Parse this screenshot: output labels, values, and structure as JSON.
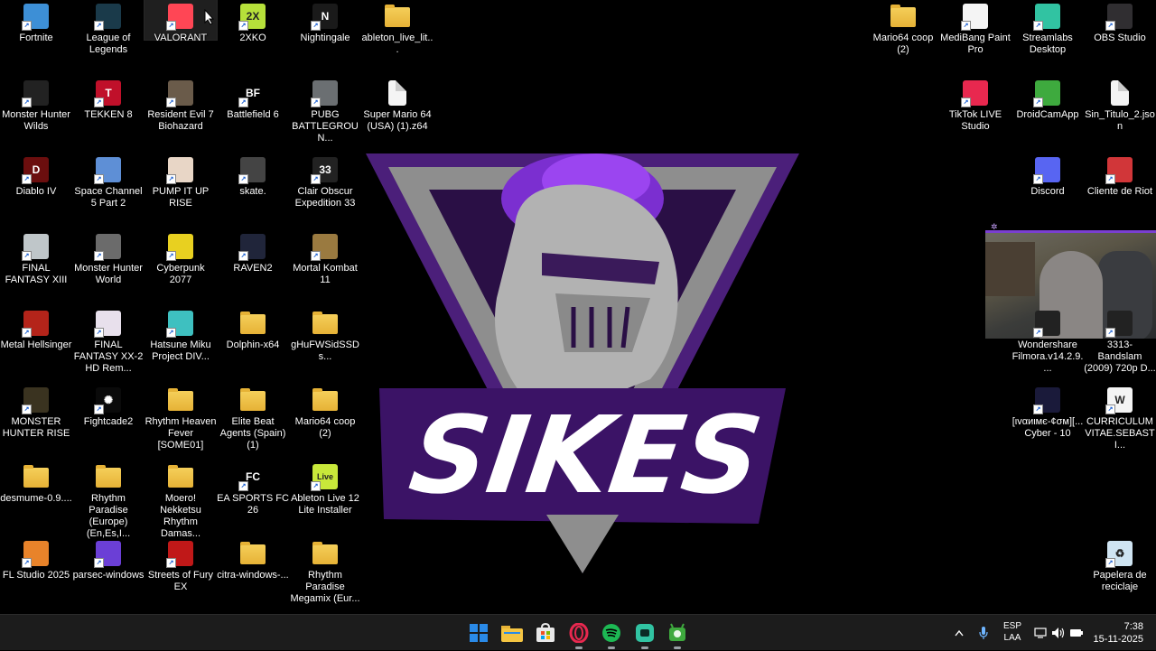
{
  "desktop": {
    "col1": [
      {
        "label": "Fortnite",
        "icon": "fortnite-icon",
        "color": "#3d8fd6",
        "glyph": ""
      },
      {
        "label": "Monster Hunter Wilds",
        "icon": "monster-hunter-wilds-icon",
        "color": "#222",
        "glyph": ""
      },
      {
        "label": "Diablo IV",
        "icon": "diablo-iv-icon",
        "color": "#6b0e0e",
        "glyph": "D"
      },
      {
        "label": "FINAL FANTASY XIII",
        "icon": "final-fantasy-xiii-icon",
        "color": "#bfc6c9",
        "glyph": ""
      },
      {
        "label": "Metal Hellsinger",
        "icon": "metal-hellsinger-icon",
        "color": "#b4241a",
        "glyph": ""
      },
      {
        "label": "MONSTER HUNTER RISE",
        "icon": "monster-hunter-rise-icon",
        "color": "#3a3320",
        "glyph": ""
      },
      {
        "label": "desmume-0.9....",
        "icon": "folder-icon",
        "folder": true
      },
      {
        "label": "FL Studio 2025",
        "icon": "fl-studio-icon",
        "color": "#e8832a",
        "glyph": ""
      }
    ],
    "col2": [
      {
        "label": "League of Legends",
        "icon": "league-of-legends-icon",
        "color": "#1a3a4a",
        "glyph": ""
      },
      {
        "label": "TEKKEN 8",
        "icon": "tekken-8-icon",
        "color": "#c0102a",
        "glyph": "T"
      },
      {
        "label": "Space Channel 5 Part 2",
        "icon": "space-channel-5-icon",
        "color": "#5e8fd6",
        "glyph": ""
      },
      {
        "label": "Monster Hunter World",
        "icon": "monster-hunter-world-icon",
        "color": "#6b6b6b",
        "glyph": ""
      },
      {
        "label": "FINAL FANTASY XX-2 HD Rem...",
        "icon": "final-fantasy-x-icon",
        "color": "#e8e0ec",
        "glyph": ""
      },
      {
        "label": "Fightcade2",
        "icon": "fightcade-icon",
        "color": "#0a0a0a",
        "glyph": "✺"
      },
      {
        "label": "Rhythm Paradise (Europe) (En,Es,I...",
        "icon": "folder-icon",
        "folder": true
      },
      {
        "label": "parsec-windows",
        "icon": "parsec-icon",
        "color": "#6b3fd6",
        "glyph": ""
      }
    ],
    "col3": [
      {
        "label": "VALORANT",
        "icon": "valorant-icon",
        "color": "#ff4655",
        "glyph": ""
      },
      {
        "label": "Resident Evil 7 Biohazard",
        "icon": "resident-evil-7-icon",
        "color": "#6a5b4a",
        "glyph": ""
      },
      {
        "label": "PUMP IT UP RISE",
        "icon": "pump-it-up-icon",
        "color": "#e8d6c6",
        "glyph": ""
      },
      {
        "label": "Cyberpunk 2077",
        "icon": "cyberpunk-icon",
        "color": "#e8d020",
        "glyph": ""
      },
      {
        "label": "Hatsune Miku Project DIV...",
        "icon": "hatsune-miku-icon",
        "color": "#3ec0c0",
        "glyph": ""
      },
      {
        "label": "Rhythm Heaven Fever [SOME01]",
        "icon": "folder-icon",
        "folder": true
      },
      {
        "label": "Moero! Nekketsu Rhythm Damas...",
        "icon": "folder-icon",
        "folder": true
      },
      {
        "label": "Streets of Fury EX",
        "icon": "streets-of-fury-icon",
        "color": "#c01818",
        "glyph": ""
      }
    ],
    "col4": [
      {
        "label": "2XKO",
        "icon": "2xko-icon",
        "color": "#b6e03a",
        "glyph": "2X"
      },
      {
        "label": "Battlefield 6",
        "icon": "battlefield-6-icon",
        "color": "#000",
        "glyph": "BF"
      },
      {
        "label": "skate.",
        "icon": "skate-icon",
        "color": "#444",
        "glyph": ""
      },
      {
        "label": "RAVEN2",
        "icon": "raven2-icon",
        "color": "#20253a",
        "glyph": ""
      },
      {
        "label": "Dolphin-x64",
        "icon": "folder-icon",
        "folder": true
      },
      {
        "label": "Elite Beat Agents (Spain) (1)",
        "icon": "folder-icon",
        "folder": true
      },
      {
        "label": "EA SPORTS FC 26",
        "icon": "ea-sports-fc-icon",
        "color": "#000",
        "glyph": "FC"
      },
      {
        "label": "citra-windows-...",
        "icon": "folder-icon",
        "folder": true
      }
    ],
    "col5": [
      {
        "label": "Nightingale",
        "icon": "nightingale-icon",
        "color": "#1a1a1a",
        "glyph": "N"
      },
      {
        "label": "PUBG BATTLEGROUN...",
        "icon": "pubg-icon",
        "color": "#6b6f72",
        "glyph": ""
      },
      {
        "label": "Clair Obscur Expedition 33",
        "icon": "clair-obscur-icon",
        "color": "#222",
        "glyph": "33"
      },
      {
        "label": "Mortal Kombat 11",
        "icon": "mortal-kombat-icon",
        "color": "#9a7a40",
        "glyph": ""
      },
      {
        "label": "gHuFWSidSSDs...",
        "icon": "folder-icon",
        "folder": true
      },
      {
        "label": "Mario64 coop (2)",
        "icon": "folder-icon",
        "folder": true
      },
      {
        "label": "Ableton Live 12 Lite Installer",
        "icon": "ableton-live-icon",
        "color": "#c8e83a",
        "glyph": "Live"
      },
      {
        "label": "Rhythm Paradise Megamix (Eur...",
        "icon": "folder-icon",
        "folder": true
      }
    ],
    "col6": [
      {
        "label": "ableton_live_lit...",
        "icon": "folder-icon",
        "folder": true
      },
      {
        "label": "Super Mario 64 (USA) (1).z64",
        "icon": "file-icon",
        "file": true
      }
    ],
    "right": [
      {
        "label": "Mario64 coop (2)",
        "icon": "folder-icon",
        "folder": true,
        "col": 0,
        "row": 0
      },
      {
        "label": "MediBang Paint Pro",
        "icon": "medibang-paint-icon",
        "color": "#f4f4f4",
        "glyph": "",
        "col": 1,
        "row": 0
      },
      {
        "label": "Streamlabs Desktop",
        "icon": "streamlabs-icon",
        "color": "#31c3a2",
        "glyph": "",
        "col": 2,
        "row": 0
      },
      {
        "label": "OBS Studio",
        "icon": "obs-studio-icon",
        "color": "#302e31",
        "glyph": "",
        "col": 3,
        "row": 0
      },
      {
        "label": "TikTok LIVE Studio",
        "icon": "tiktok-live-icon",
        "color": "#e8284f",
        "glyph": "",
        "col": 1,
        "row": 1
      },
      {
        "label": "DroidCamApp",
        "icon": "droidcam-icon",
        "color": "#3eaa3e",
        "glyph": "",
        "col": 2,
        "row": 1
      },
      {
        "label": "Sin_Titulo_2.json",
        "icon": "file-icon",
        "file": true,
        "col": 3,
        "row": 1
      },
      {
        "label": "Discord",
        "icon": "discord-icon",
        "color": "#5865f2",
        "glyph": "",
        "col": 2,
        "row": 2
      },
      {
        "label": "Cliente de Riot",
        "icon": "riot-client-icon",
        "color": "#d13639",
        "glyph": "",
        "col": 3,
        "row": 2
      },
      {
        "label": "Wondershare Filmora.v14.2.9....",
        "icon": "filmora-icon",
        "color": "#222",
        "glyph": "",
        "col": 2,
        "row": 4
      },
      {
        "label": "3313- Bandslam (2009) 720p D...",
        "icon": "video-file-icon",
        "color": "#222",
        "glyph": "",
        "col": 3,
        "row": 4
      },
      {
        "label": "[ιvαиιмє-¢σм][... Cyber - 10",
        "icon": "video-file-icon",
        "color": "#1a1a3a",
        "glyph": "",
        "col": 2,
        "row": 5
      },
      {
        "label": "CURRICULUM VITAE.SEBASTI...",
        "icon": "word-document-icon",
        "color": "#f4f4f4",
        "glyph": "W",
        "col": 3,
        "row": 5
      },
      {
        "label": "Papelera de reciclaje",
        "icon": "recycle-bin-icon",
        "color": "#cfe4f2",
        "glyph": "♻",
        "col": 3,
        "row": 7
      }
    ]
  },
  "wallpaper": {
    "text": "SIKES",
    "purple": "#4b1f7a",
    "accent": "#8a2be2",
    "gray": "#9a9a9a"
  },
  "webcam": {
    "tag": "✲"
  },
  "taskbar": {
    "apps": [
      {
        "name": "start-button-icon",
        "color": "#2a8ae8"
      },
      {
        "name": "file-explorer-icon",
        "color": "#f5c542"
      },
      {
        "name": "microsoft-store-icon",
        "color": "#2a8ae8"
      },
      {
        "name": "opera-gx-icon",
        "color": "#e8284f"
      },
      {
        "name": "spotify-icon",
        "color": "#1db954"
      },
      {
        "name": "streamlabs-taskbar-icon",
        "color": "#31c3a2"
      },
      {
        "name": "droidcam-taskbar-icon",
        "color": "#3eaa3e"
      }
    ],
    "lang_top": "ESP",
    "lang_bottom": "LAA",
    "time": "7:38",
    "date": "15-11-2025"
  }
}
